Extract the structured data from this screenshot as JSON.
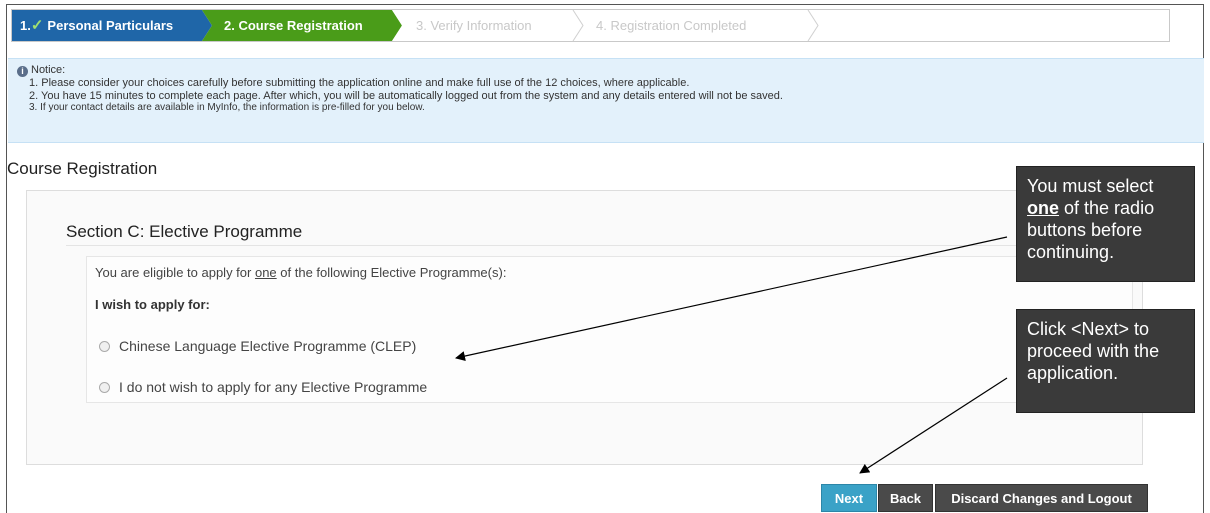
{
  "steps": [
    {
      "label": "Personal Particulars",
      "prefix": "1."
    },
    {
      "label": "2. Course Registration"
    },
    {
      "label": "3. Verify Information"
    },
    {
      "label": "4. Registration Completed"
    }
  ],
  "notice": {
    "heading": "Notice:",
    "items": [
      "1. Please consider your choices carefully before submitting the application online and make full use of the 12 choices, where applicable.",
      "2. You have 15 minutes to complete each page. After which, you will be automatically logged out from the system and any details entered will not be saved.",
      "3. If your contact details are available in MyInfo, the information is pre-filled for you below."
    ]
  },
  "page_title": "Course Registration",
  "section": {
    "title": "Section C: Elective Programme",
    "eligible_pre": "You are eligible to apply for ",
    "eligible_em": "one",
    "eligible_post": " of the following Elective Programme(s):",
    "wish": "I wish to apply for:",
    "options": [
      "Chinese Language Elective Programme (CLEP)",
      "I do not wish to apply for any Elective Programme"
    ]
  },
  "buttons": {
    "next": "Next",
    "back": "Back",
    "discard": "Discard Changes and Logout"
  },
  "callouts": {
    "c1_pre": "You must select ",
    "c1_em": "one",
    "c1_post": " of the radio buttons before continuing.",
    "c2": "Click <Next> to proceed with the application."
  },
  "colors": {
    "step_done": "#1f66a8",
    "step_active": "#4a9c19",
    "next_button": "#3aa2c7",
    "notice_bg": "#e3f1fb"
  }
}
